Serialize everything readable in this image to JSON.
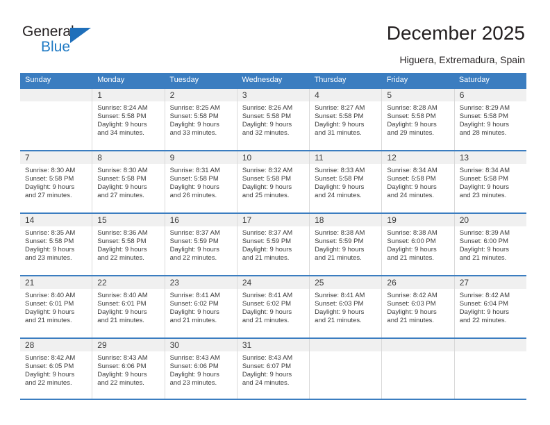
{
  "brand": {
    "name_top": "General",
    "name_bottom": "Blue",
    "accent_color": "#1f6fba",
    "top_color": "#231f20",
    "triangle_icon": "triangle-icon"
  },
  "header": {
    "title": "December 2025",
    "subtitle": "Higuera, Extremadura, Spain"
  },
  "calendar": {
    "header_bg": "#3b7dc0",
    "header_text_color": "#ffffff",
    "daynumber_bg": "#f0f0f0",
    "weekdays": [
      "Sunday",
      "Monday",
      "Tuesday",
      "Wednesday",
      "Thursday",
      "Friday",
      "Saturday"
    ],
    "weeks": [
      [
        {
          "day": "",
          "lines": []
        },
        {
          "day": "1",
          "lines": [
            "Sunrise: 8:24 AM",
            "Sunset: 5:58 PM",
            "Daylight: 9 hours",
            "and 34 minutes."
          ]
        },
        {
          "day": "2",
          "lines": [
            "Sunrise: 8:25 AM",
            "Sunset: 5:58 PM",
            "Daylight: 9 hours",
            "and 33 minutes."
          ]
        },
        {
          "day": "3",
          "lines": [
            "Sunrise: 8:26 AM",
            "Sunset: 5:58 PM",
            "Daylight: 9 hours",
            "and 32 minutes."
          ]
        },
        {
          "day": "4",
          "lines": [
            "Sunrise: 8:27 AM",
            "Sunset: 5:58 PM",
            "Daylight: 9 hours",
            "and 31 minutes."
          ]
        },
        {
          "day": "5",
          "lines": [
            "Sunrise: 8:28 AM",
            "Sunset: 5:58 PM",
            "Daylight: 9 hours",
            "and 29 minutes."
          ]
        },
        {
          "day": "6",
          "lines": [
            "Sunrise: 8:29 AM",
            "Sunset: 5:58 PM",
            "Daylight: 9 hours",
            "and 28 minutes."
          ]
        }
      ],
      [
        {
          "day": "7",
          "lines": [
            "Sunrise: 8:30 AM",
            "Sunset: 5:58 PM",
            "Daylight: 9 hours",
            "and 27 minutes."
          ]
        },
        {
          "day": "8",
          "lines": [
            "Sunrise: 8:30 AM",
            "Sunset: 5:58 PM",
            "Daylight: 9 hours",
            "and 27 minutes."
          ]
        },
        {
          "day": "9",
          "lines": [
            "Sunrise: 8:31 AM",
            "Sunset: 5:58 PM",
            "Daylight: 9 hours",
            "and 26 minutes."
          ]
        },
        {
          "day": "10",
          "lines": [
            "Sunrise: 8:32 AM",
            "Sunset: 5:58 PM",
            "Daylight: 9 hours",
            "and 25 minutes."
          ]
        },
        {
          "day": "11",
          "lines": [
            "Sunrise: 8:33 AM",
            "Sunset: 5:58 PM",
            "Daylight: 9 hours",
            "and 24 minutes."
          ]
        },
        {
          "day": "12",
          "lines": [
            "Sunrise: 8:34 AM",
            "Sunset: 5:58 PM",
            "Daylight: 9 hours",
            "and 24 minutes."
          ]
        },
        {
          "day": "13",
          "lines": [
            "Sunrise: 8:34 AM",
            "Sunset: 5:58 PM",
            "Daylight: 9 hours",
            "and 23 minutes."
          ]
        }
      ],
      [
        {
          "day": "14",
          "lines": [
            "Sunrise: 8:35 AM",
            "Sunset: 5:58 PM",
            "Daylight: 9 hours",
            "and 23 minutes."
          ]
        },
        {
          "day": "15",
          "lines": [
            "Sunrise: 8:36 AM",
            "Sunset: 5:58 PM",
            "Daylight: 9 hours",
            "and 22 minutes."
          ]
        },
        {
          "day": "16",
          "lines": [
            "Sunrise: 8:37 AM",
            "Sunset: 5:59 PM",
            "Daylight: 9 hours",
            "and 22 minutes."
          ]
        },
        {
          "day": "17",
          "lines": [
            "Sunrise: 8:37 AM",
            "Sunset: 5:59 PM",
            "Daylight: 9 hours",
            "and 21 minutes."
          ]
        },
        {
          "day": "18",
          "lines": [
            "Sunrise: 8:38 AM",
            "Sunset: 5:59 PM",
            "Daylight: 9 hours",
            "and 21 minutes."
          ]
        },
        {
          "day": "19",
          "lines": [
            "Sunrise: 8:38 AM",
            "Sunset: 6:00 PM",
            "Daylight: 9 hours",
            "and 21 minutes."
          ]
        },
        {
          "day": "20",
          "lines": [
            "Sunrise: 8:39 AM",
            "Sunset: 6:00 PM",
            "Daylight: 9 hours",
            "and 21 minutes."
          ]
        }
      ],
      [
        {
          "day": "21",
          "lines": [
            "Sunrise: 8:40 AM",
            "Sunset: 6:01 PM",
            "Daylight: 9 hours",
            "and 21 minutes."
          ]
        },
        {
          "day": "22",
          "lines": [
            "Sunrise: 8:40 AM",
            "Sunset: 6:01 PM",
            "Daylight: 9 hours",
            "and 21 minutes."
          ]
        },
        {
          "day": "23",
          "lines": [
            "Sunrise: 8:41 AM",
            "Sunset: 6:02 PM",
            "Daylight: 9 hours",
            "and 21 minutes."
          ]
        },
        {
          "day": "24",
          "lines": [
            "Sunrise: 8:41 AM",
            "Sunset: 6:02 PM",
            "Daylight: 9 hours",
            "and 21 minutes."
          ]
        },
        {
          "day": "25",
          "lines": [
            "Sunrise: 8:41 AM",
            "Sunset: 6:03 PM",
            "Daylight: 9 hours",
            "and 21 minutes."
          ]
        },
        {
          "day": "26",
          "lines": [
            "Sunrise: 8:42 AM",
            "Sunset: 6:03 PM",
            "Daylight: 9 hours",
            "and 21 minutes."
          ]
        },
        {
          "day": "27",
          "lines": [
            "Sunrise: 8:42 AM",
            "Sunset: 6:04 PM",
            "Daylight: 9 hours",
            "and 22 minutes."
          ]
        }
      ],
      [
        {
          "day": "28",
          "lines": [
            "Sunrise: 8:42 AM",
            "Sunset: 6:05 PM",
            "Daylight: 9 hours",
            "and 22 minutes."
          ]
        },
        {
          "day": "29",
          "lines": [
            "Sunrise: 8:43 AM",
            "Sunset: 6:06 PM",
            "Daylight: 9 hours",
            "and 22 minutes."
          ]
        },
        {
          "day": "30",
          "lines": [
            "Sunrise: 8:43 AM",
            "Sunset: 6:06 PM",
            "Daylight: 9 hours",
            "and 23 minutes."
          ]
        },
        {
          "day": "31",
          "lines": [
            "Sunrise: 8:43 AM",
            "Sunset: 6:07 PM",
            "Daylight: 9 hours",
            "and 24 minutes."
          ]
        },
        {
          "day": "",
          "lines": []
        },
        {
          "day": "",
          "lines": []
        },
        {
          "day": "",
          "lines": []
        }
      ]
    ]
  }
}
